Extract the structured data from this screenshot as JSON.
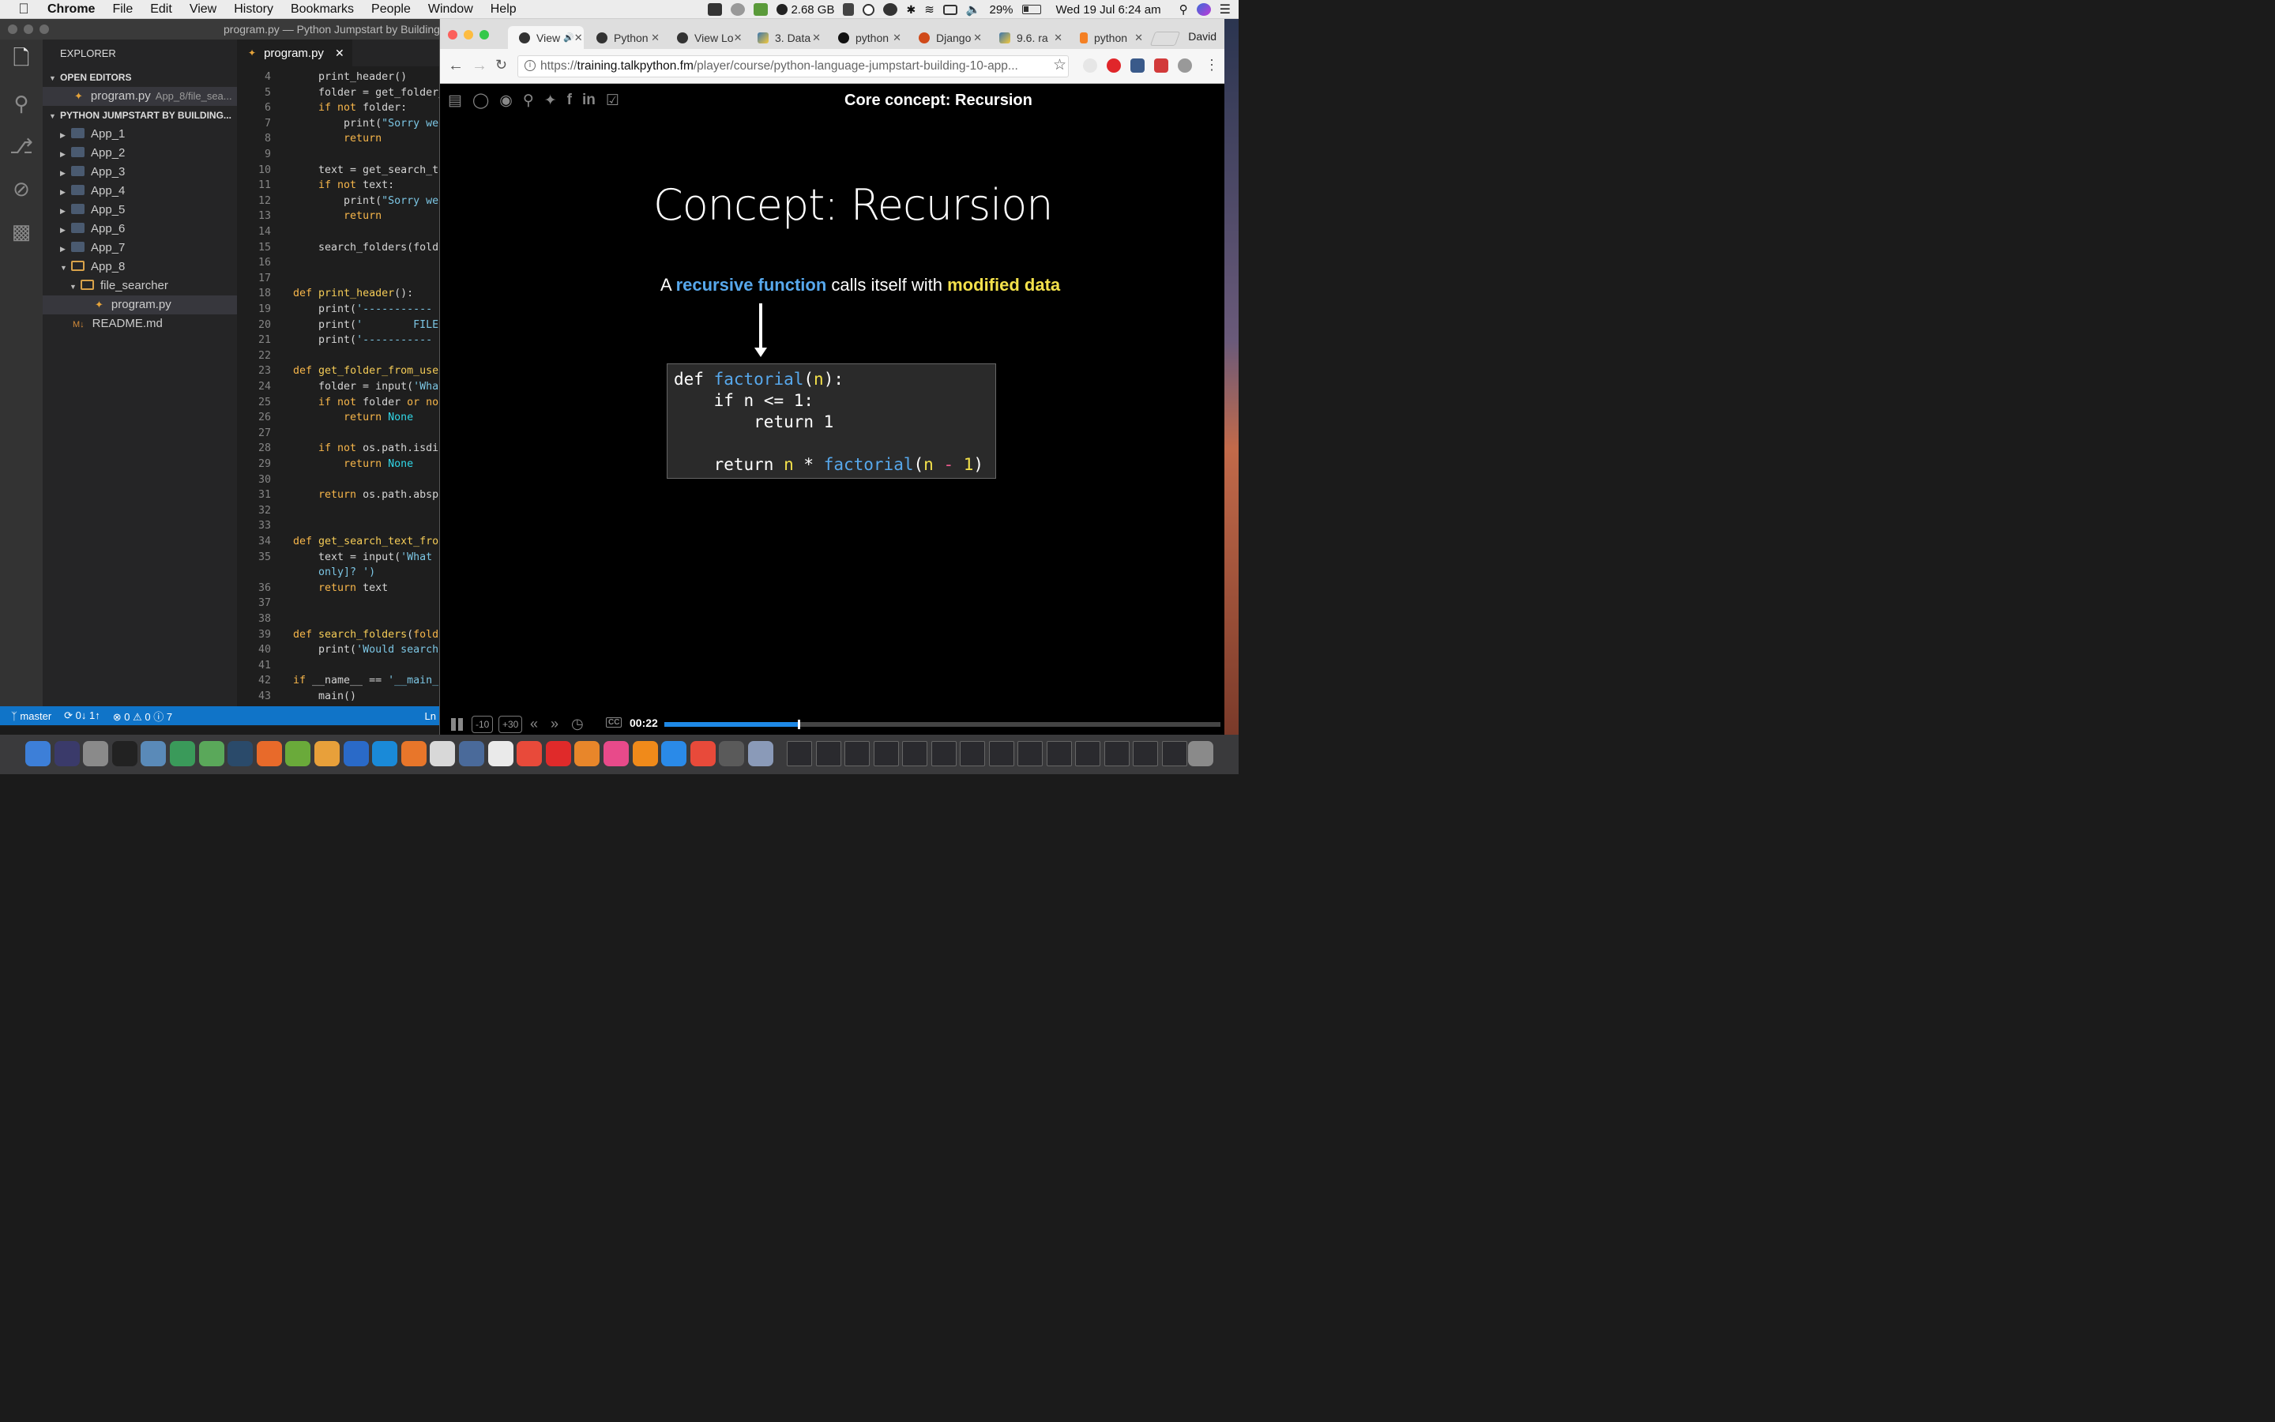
{
  "menubar": {
    "app": "Chrome",
    "items": [
      "File",
      "Edit",
      "View",
      "History",
      "Bookmarks",
      "People",
      "Window",
      "Help"
    ],
    "memory": "2.68 GB",
    "battery": "29%",
    "datetime": "Wed 19 Jul  6:24 am"
  },
  "vscode": {
    "window_title": "program.py — Python Jumpstart by Building",
    "explorer_title": "EXPLORER",
    "open_editors_label": "OPEN EDITORS",
    "open_editor": {
      "name": "program.py",
      "path": "App_8/file_sea..."
    },
    "project_label": "PYTHON JUMPSTART BY BUILDING...",
    "folders": [
      "App_1",
      "App_2",
      "App_3",
      "App_4",
      "App_5",
      "App_6",
      "App_7",
      "App_8"
    ],
    "subfolder": "file_searcher",
    "file": "program.py",
    "readme": "README.md",
    "tab": "program.py",
    "code": [
      {
        "n": "4",
        "html": "    print_header()"
      },
      {
        "n": "5",
        "html": "    folder = get_folder_"
      },
      {
        "n": "6",
        "html": "    <span class=\"k\">if not</span> folder:"
      },
      {
        "n": "7",
        "html": "        print(<span class=\"s\">\"Sorry we</span>"
      },
      {
        "n": "8",
        "html": "        <span class=\"k\">return</span>"
      },
      {
        "n": "9",
        "html": ""
      },
      {
        "n": "10",
        "html": "    text = get_search_te"
      },
      {
        "n": "11",
        "html": "    <span class=\"k\">if not</span> text:"
      },
      {
        "n": "12",
        "html": "        print(<span class=\"s\">\"Sorry we</span>"
      },
      {
        "n": "13",
        "html": "        <span class=\"k\">return</span>"
      },
      {
        "n": "14",
        "html": ""
      },
      {
        "n": "15",
        "html": "    search_folders(folde"
      },
      {
        "n": "16",
        "html": ""
      },
      {
        "n": "17",
        "html": ""
      },
      {
        "n": "18",
        "html": "<span class=\"k\">def</span> <span class=\"f\">print_header</span>():"
      },
      {
        "n": "19",
        "html": "    print(<span class=\"s\">'-----------</span>"
      },
      {
        "n": "20",
        "html": "    print(<span class=\"s\">'        FILE</span>"
      },
      {
        "n": "21",
        "html": "    print(<span class=\"s\">'-----------</span>"
      },
      {
        "n": "22",
        "html": ""
      },
      {
        "n": "23",
        "html": "<span class=\"k\">def</span> <span class=\"f\">get_folder_from_use</span>"
      },
      {
        "n": "24",
        "html": "    folder = input(<span class=\"s\">'What</span>"
      },
      {
        "n": "25",
        "html": "    <span class=\"k\">if not</span> folder <span class=\"k\">or not</span>"
      },
      {
        "n": "26",
        "html": "        <span class=\"k\">return</span> <span class=\"c\">None</span>"
      },
      {
        "n": "27",
        "html": ""
      },
      {
        "n": "28",
        "html": "    <span class=\"k\">if not</span> os.path.isdi"
      },
      {
        "n": "29",
        "html": "        <span class=\"k\">return</span> <span class=\"c\">None</span>"
      },
      {
        "n": "30",
        "html": ""
      },
      {
        "n": "31",
        "html": "    <span class=\"k\">return</span> os.path.abspa"
      },
      {
        "n": "32",
        "html": ""
      },
      {
        "n": "33",
        "html": ""
      },
      {
        "n": "34",
        "html": "<span class=\"k\">def</span> <span class=\"f\">get_search_text_fro</span>"
      },
      {
        "n": "35",
        "html": "    text = input(<span class=\"s\">'What a</span>"
      },
      {
        "n": "",
        "html": "    <span class=\"s\">only]? ')</span>"
      },
      {
        "n": "36",
        "html": "    <span class=\"k\">return</span> text"
      },
      {
        "n": "37",
        "html": ""
      },
      {
        "n": "38",
        "html": ""
      },
      {
        "n": "39",
        "html": "<span class=\"k\">def</span> <span class=\"f\">search_folders</span>(<span class=\"k\">folde</span>"
      },
      {
        "n": "40",
        "html": "    print(<span class=\"s\">'Would search</span>"
      },
      {
        "n": "41",
        "html": ""
      },
      {
        "n": "42",
        "html": "<span class=\"k\">if</span> __name__ == <span class=\"s\">'__main_</span>"
      },
      {
        "n": "43",
        "html": "    main()"
      }
    ],
    "status": {
      "branch": "master",
      "sync": "0↓ 1↑",
      "problems": "0",
      "warnings": "0",
      "info": "7",
      "position": "Ln"
    }
  },
  "chrome": {
    "tabs": [
      "View",
      "Python",
      "View Lo",
      "3. Data",
      "python",
      "Django",
      "9.6. ra",
      "python"
    ],
    "user": "David",
    "url_prefix": "https://",
    "url_domain": "training.talkpython.fm",
    "url_rest": "/player/course/python-language-jumpstart-building-10-app..."
  },
  "player": {
    "header_title": "Core concept: Recursion",
    "slide_title": "Concept: Recursion",
    "subtitle": {
      "a": "A ",
      "b": "recursive function",
      "c": " calls itself with ",
      "d": "modified data"
    },
    "code": [
      "<span>def</span> <span class=\"cb\">factorial</span>(<span class=\"cy\">n</span>):",
      "    <span>if</span> n <span>&lt;=</span> 1:",
      "        <span>return</span> 1",
      "",
      "    <span>return</span> <span class=\"cy\">n</span> * <span class=\"cb\">factorial</span>(<span class=\"cy\">n</span> <span class=\"cp\">-</span> <span class=\"cy\">1</span>)"
    ],
    "back_label": "-10",
    "fwd_label": "+30",
    "cc_label": "CC",
    "time": "00:22",
    "progress": 0.24
  }
}
